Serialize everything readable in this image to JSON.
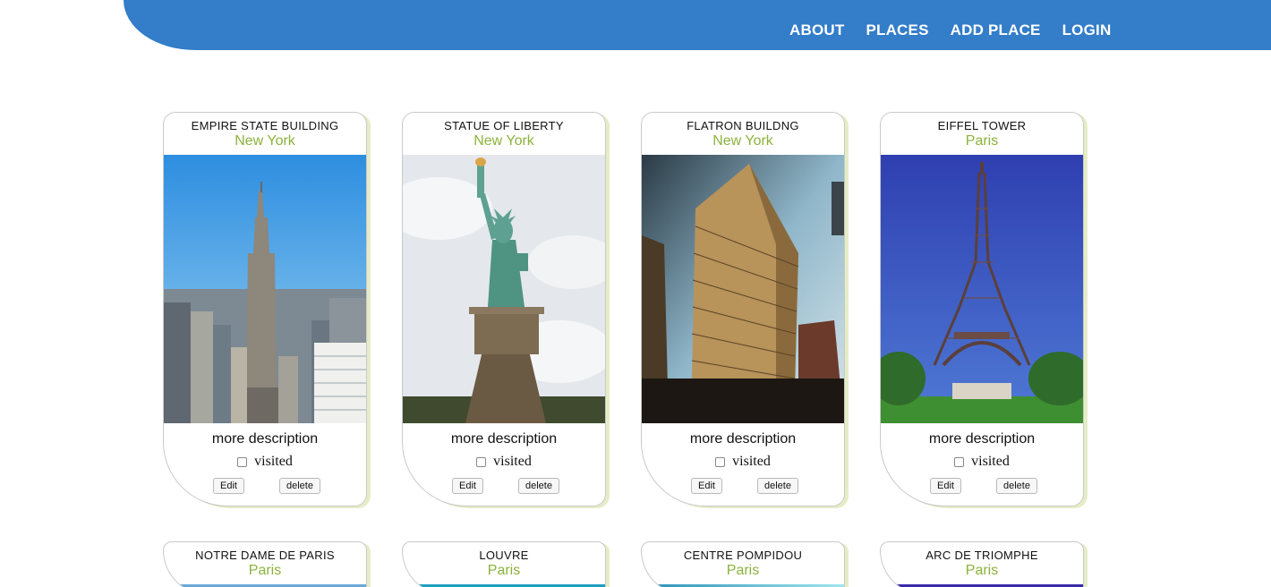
{
  "nav": {
    "items": [
      "ABOUT",
      "PLACES",
      "ADD PLACE",
      "LOGIN"
    ]
  },
  "colors": {
    "header": "#337dc9",
    "city": "#8bb23b",
    "shadow": "#e5edc6"
  },
  "cards": [
    {
      "title": "EMPIRE STATE BUILDING",
      "city": "New York",
      "description": "more description",
      "visited_label": "visited",
      "visited": false,
      "edit_label": "Edit",
      "delete_label": "delete",
      "image": "empire-state-building-photo"
    },
    {
      "title": "STATUE OF LIBERTY",
      "city": "New York",
      "description": "more description",
      "visited_label": "visited",
      "visited": false,
      "edit_label": "Edit",
      "delete_label": "delete",
      "image": "statue-of-liberty-photo"
    },
    {
      "title": "FLATRON BUILDNG",
      "city": "New York",
      "description": "more description",
      "visited_label": "visited",
      "visited": false,
      "edit_label": "Edit",
      "delete_label": "delete",
      "image": "flatiron-building-photo"
    },
    {
      "title": "EIFFEL TOWER",
      "city": "Paris",
      "description": "more description",
      "visited_label": "visited",
      "visited": false,
      "edit_label": "Edit",
      "delete_label": "delete",
      "image": "eiffel-tower-photo"
    },
    {
      "title": "NOTRE DAME DE PARIS",
      "city": "Paris"
    },
    {
      "title": "LOUVRE",
      "city": "Paris"
    },
    {
      "title": "CENTRE POMPIDOU",
      "city": "Paris"
    },
    {
      "title": "ARC DE TRIOMPHE",
      "city": "Paris"
    }
  ]
}
